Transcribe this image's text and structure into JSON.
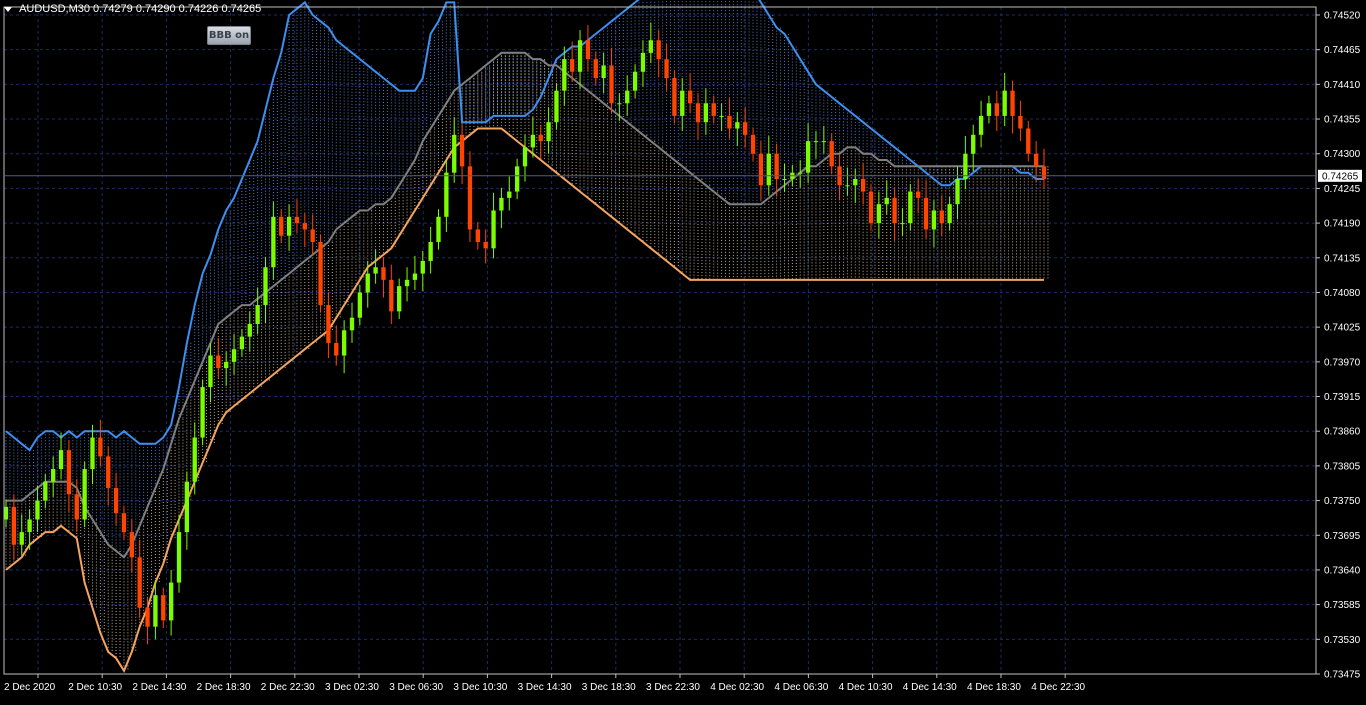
{
  "header": {
    "symbol_info": "AUDUSD,M30  0.74279 0.74290 0.74226 0.74265",
    "bbb_button_label": "BBB on"
  },
  "colors": {
    "background": "#000000",
    "grid": "#1c2a6b",
    "axis": "#c0c0c0",
    "bull": "#7cfc00",
    "bear": "#ff4500",
    "upper_band": "#3d8ff0",
    "lower_band": "#f4a460",
    "middle_band": "#808080",
    "upper_fill": "#6f9fff",
    "lower_fill": "#ffe3b0",
    "current_price_line": "#4a5a9a"
  },
  "chart_data": {
    "type": "candlestick",
    "y_axis": {
      "min": 0.73475,
      "max": 0.7452,
      "ticks": [
        "0.74520",
        "0.74465",
        "0.74410",
        "0.74355",
        "0.74300",
        "0.74245",
        "0.74190",
        "0.74135",
        "0.74080",
        "0.74025",
        "0.73970",
        "0.73915",
        "0.73860",
        "0.73805",
        "0.73750",
        "0.73695",
        "0.73640",
        "0.73585",
        "0.73530",
        "0.73475"
      ]
    },
    "x_axis": {
      "labels": [
        "2 Dec 2020",
        "2 Dec 10:30",
        "2 Dec 14:30",
        "2 Dec 18:30",
        "2 Dec 22:30",
        "3 Dec 02:30",
        "3 Dec 06:30",
        "3 Dec 10:30",
        "3 Dec 14:30",
        "3 Dec 18:30",
        "3 Dec 22:30",
        "4 Dec 02:30",
        "4 Dec 06:30",
        "4 Dec 10:30",
        "4 Dec 14:30",
        "4 Dec 18:30",
        "4 Dec 22:30"
      ]
    },
    "current_price": "0.74265",
    "closes": [
      0.7374,
      0.7368,
      0.737,
      0.7372,
      0.7375,
      0.7378,
      0.738,
      0.7383,
      0.7376,
      0.7372,
      0.738,
      0.7385,
      0.7382,
      0.7377,
      0.7373,
      0.737,
      0.7366,
      0.7358,
      0.7355,
      0.736,
      0.7356,
      0.7362,
      0.737,
      0.7378,
      0.7385,
      0.7393,
      0.7398,
      0.7396,
      0.7397,
      0.7399,
      0.7401,
      0.7403,
      0.7406,
      0.7412,
      0.742,
      0.7417,
      0.742,
      0.7419,
      0.7418,
      0.7416,
      0.7406,
      0.74,
      0.7398,
      0.7402,
      0.7404,
      0.7408,
      0.7411,
      0.7412,
      0.741,
      0.7405,
      0.7409,
      0.741,
      0.7411,
      0.7413,
      0.7416,
      0.742,
      0.7427,
      0.7433,
      0.7428,
      0.7418,
      0.7416,
      0.7415,
      0.7421,
      0.7423,
      0.7424,
      0.7428,
      0.7431,
      0.7433,
      0.7432,
      0.7435,
      0.744,
      0.7445,
      0.7443,
      0.7448,
      0.7445,
      0.7442,
      0.7444,
      0.7438,
      0.7438,
      0.744,
      0.7443,
      0.7446,
      0.7448,
      0.7445,
      0.7442,
      0.7436,
      0.744,
      0.7438,
      0.7435,
      0.7438,
      0.7436,
      0.7436,
      0.7434,
      0.7435,
      0.7433,
      0.743,
      0.7425,
      0.743,
      0.7426,
      0.7426,
      0.7427,
      0.7427,
      0.7432,
      0.7432,
      0.7432,
      0.7428,
      0.7425,
      0.7425,
      0.7426,
      0.7424,
      0.7419,
      0.7422,
      0.7423,
      0.7419,
      0.7419,
      0.7424,
      0.7423,
      0.7418,
      0.7421,
      0.7419,
      0.7422,
      0.7426,
      0.743,
      0.7433,
      0.7436,
      0.7438,
      0.7436,
      0.744,
      0.7436,
      0.7434,
      0.743,
      0.7428,
      0.7426
    ],
    "upper_band": [
      0.7386,
      0.7385,
      0.7384,
      0.7383,
      0.7385,
      0.7386,
      0.7386,
      0.7385,
      0.7386,
      0.7385,
      0.7386,
      0.7386,
      0.7386,
      0.7386,
      0.7385,
      0.7386,
      0.7385,
      0.7384,
      0.7384,
      0.7384,
      0.7385,
      0.7387,
      0.7393,
      0.74,
      0.7406,
      0.7411,
      0.7414,
      0.7418,
      0.7421,
      0.7423,
      0.7426,
      0.7429,
      0.7432,
      0.7437,
      0.7442,
      0.7446,
      0.7452,
      0.7453,
      0.7454,
      0.7452,
      0.7451,
      0.745,
      0.7448,
      0.7447,
      0.7446,
      0.7445,
      0.7444,
      0.7443,
      0.7442,
      0.7441,
      0.744,
      0.744,
      0.744,
      0.7442,
      0.7449,
      0.7451,
      0.7454,
      0.7454,
      0.7435,
      0.7435,
      0.7435,
      0.7435,
      0.7436,
      0.7436,
      0.7436,
      0.7436,
      0.7436,
      0.7437,
      0.7439,
      0.7442,
      0.7445,
      0.7446,
      0.7447,
      0.7447,
      0.7448,
      0.7449,
      0.745,
      0.7451,
      0.7452,
      0.7453,
      0.7454,
      0.7455,
      0.7456,
      0.7457,
      0.7458,
      0.7458,
      0.7458,
      0.7458,
      0.7458,
      0.7458,
      0.7458,
      0.7458,
      0.7458,
      0.7458,
      0.7457,
      0.7456,
      0.7454,
      0.7452,
      0.745,
      0.7449,
      0.7447,
      0.7445,
      0.7443,
      0.7441,
      0.744,
      0.7439,
      0.7438,
      0.7437,
      0.7436,
      0.7435,
      0.7434,
      0.7433,
      0.7432,
      0.7431,
      0.743,
      0.7429,
      0.7428,
      0.7427,
      0.7426,
      0.7425,
      0.7425,
      0.7426,
      0.7426,
      0.7427,
      0.7428,
      0.7428,
      0.7428,
      0.7428,
      0.7428,
      0.7427,
      0.7427,
      0.7426,
      0.7426
    ],
    "middle_band": [
      0.7375,
      0.7375,
      0.7375,
      0.7376,
      0.7377,
      0.7378,
      0.7378,
      0.7378,
      0.7378,
      0.7377,
      0.7374,
      0.7372,
      0.737,
      0.7368,
      0.7367,
      0.7366,
      0.7368,
      0.7371,
      0.7374,
      0.7377,
      0.738,
      0.7384,
      0.7388,
      0.7391,
      0.7394,
      0.7397,
      0.74,
      0.7403,
      0.7404,
      0.7405,
      0.7406,
      0.7406,
      0.7407,
      0.7408,
      0.7409,
      0.741,
      0.7411,
      0.7412,
      0.7413,
      0.7414,
      0.7415,
      0.7416,
      0.7418,
      0.7419,
      0.742,
      0.7421,
      0.7421,
      0.7422,
      0.7422,
      0.7423,
      0.7425,
      0.7427,
      0.7429,
      0.7432,
      0.7434,
      0.7436,
      0.7438,
      0.744,
      0.7441,
      0.7442,
      0.7443,
      0.7444,
      0.7445,
      0.7446,
      0.7446,
      0.7446,
      0.7446,
      0.7445,
      0.7445,
      0.7444,
      0.7444,
      0.7443,
      0.7442,
      0.7441,
      0.744,
      0.7439,
      0.7438,
      0.7437,
      0.7436,
      0.7435,
      0.7434,
      0.7433,
      0.7432,
      0.7431,
      0.743,
      0.7429,
      0.7428,
      0.7427,
      0.7426,
      0.7425,
      0.7424,
      0.7423,
      0.7422,
      0.7422,
      0.7422,
      0.7422,
      0.7422,
      0.7423,
      0.7424,
      0.7425,
      0.7426,
      0.7427,
      0.7428,
      0.7428,
      0.7429,
      0.743,
      0.743,
      0.7431,
      0.7431,
      0.743,
      0.743,
      0.7429,
      0.7429,
      0.7428,
      0.7428,
      0.7428,
      0.7428,
      0.7428,
      0.7428,
      0.7428,
      0.7428,
      0.7428,
      0.7428,
      0.7428,
      0.7428,
      0.7428,
      0.7428,
      0.7428,
      0.7428,
      0.7428,
      0.7428,
      0.7428,
      0.7428
    ],
    "lower_band": [
      0.7364,
      0.7365,
      0.7366,
      0.7368,
      0.7369,
      0.737,
      0.737,
      0.7371,
      0.737,
      0.7369,
      0.7362,
      0.7358,
      0.7354,
      0.7351,
      0.735,
      0.7348,
      0.7351,
      0.7355,
      0.7358,
      0.7362,
      0.7365,
      0.7369,
      0.7372,
      0.7375,
      0.7378,
      0.7381,
      0.7384,
      0.7387,
      0.7389,
      0.739,
      0.7391,
      0.7392,
      0.7393,
      0.7394,
      0.7395,
      0.7396,
      0.7397,
      0.7398,
      0.7399,
      0.74,
      0.7401,
      0.7402,
      0.7404,
      0.7406,
      0.7408,
      0.741,
      0.7412,
      0.7413,
      0.7414,
      0.7415,
      0.7417,
      0.7419,
      0.7421,
      0.7423,
      0.7425,
      0.7427,
      0.7429,
      0.7431,
      0.7432,
      0.7433,
      0.7434,
      0.7434,
      0.7434,
      0.7434,
      0.7433,
      0.7432,
      0.7431,
      0.743,
      0.7429,
      0.7428,
      0.7427,
      0.7426,
      0.7425,
      0.7424,
      0.7423,
      0.7422,
      0.7421,
      0.742,
      0.7419,
      0.7418,
      0.7417,
      0.7416,
      0.7415,
      0.7414,
      0.7413,
      0.7412,
      0.7411,
      0.741,
      0.741,
      0.741,
      0.741,
      0.741,
      0.741,
      0.741,
      0.741,
      0.741,
      0.741,
      0.741,
      0.741,
      0.741,
      0.741,
      0.741,
      0.741,
      0.741,
      0.741,
      0.741,
      0.741,
      0.741,
      0.741,
      0.741,
      0.741,
      0.741,
      0.741,
      0.741,
      0.741,
      0.741,
      0.741,
      0.741,
      0.741,
      0.741,
      0.741,
      0.741,
      0.741,
      0.741,
      0.741,
      0.741,
      0.741,
      0.741,
      0.741,
      0.741,
      0.741,
      0.741,
      0.741
    ]
  }
}
